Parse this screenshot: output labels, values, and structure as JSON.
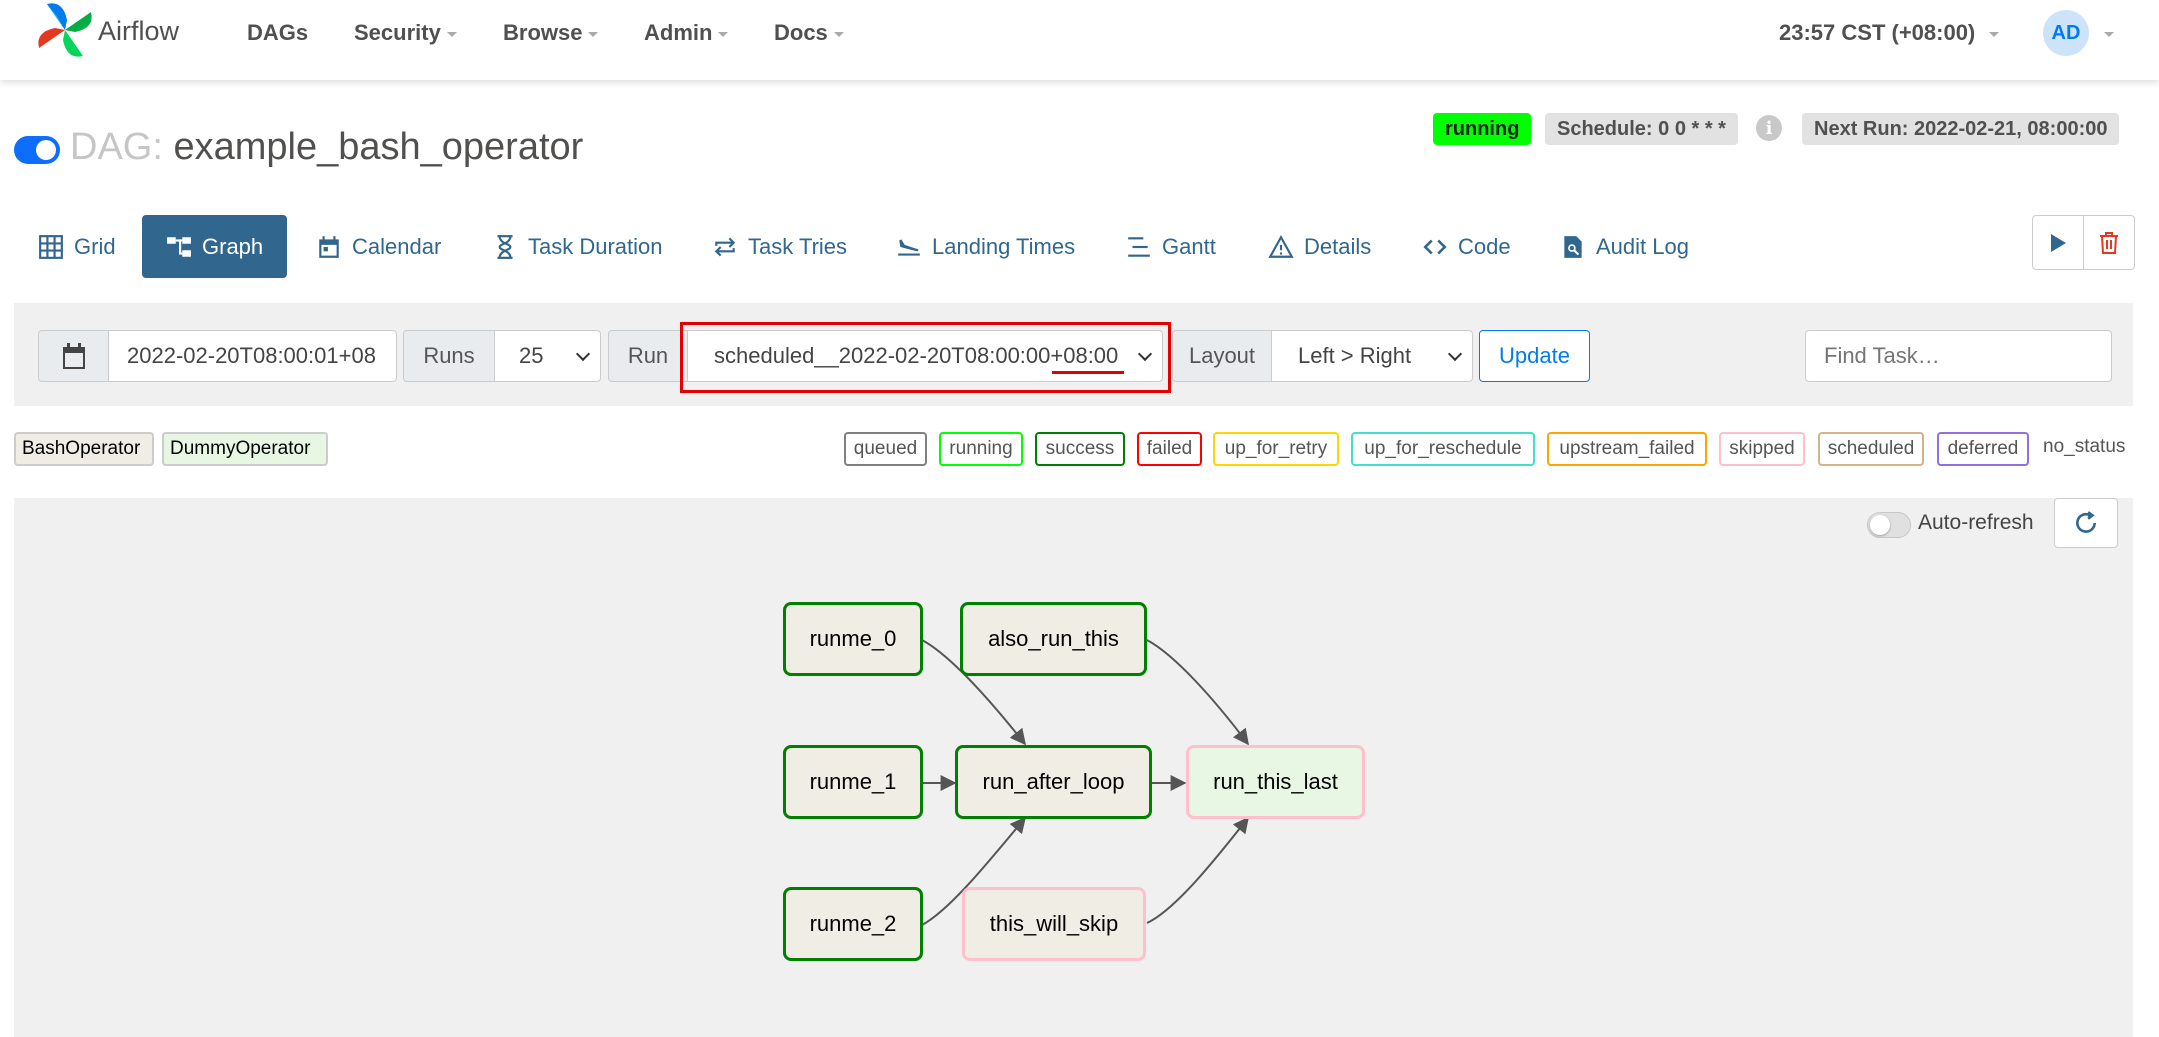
{
  "brand": {
    "name": "Airflow"
  },
  "nav": {
    "items": [
      {
        "label": "DAGs",
        "dropdown": false
      },
      {
        "label": "Security",
        "dropdown": true
      },
      {
        "label": "Browse",
        "dropdown": true
      },
      {
        "label": "Admin",
        "dropdown": true
      },
      {
        "label": "Docs",
        "dropdown": true
      }
    ],
    "clock": "23:57 CST (+08:00)",
    "user_initials": "AD"
  },
  "dag": {
    "prefix": "DAG:",
    "name": "example_bash_operator",
    "enabled": true,
    "state": "running",
    "schedule": "Schedule: 0 0 * * *",
    "next_run": "Next Run: 2022-02-21, 08:00:00"
  },
  "tabs": [
    {
      "label": "Grid",
      "icon": "grid-icon",
      "active": false
    },
    {
      "label": "Graph",
      "icon": "graph-icon",
      "active": true
    },
    {
      "label": "Calendar",
      "icon": "calendar-icon",
      "active": false
    },
    {
      "label": "Task Duration",
      "icon": "hourglass-icon",
      "active": false
    },
    {
      "label": "Task Tries",
      "icon": "repeat-icon",
      "active": false
    },
    {
      "label": "Landing Times",
      "icon": "plane-landing-icon",
      "active": false
    },
    {
      "label": "Gantt",
      "icon": "gantt-icon",
      "active": false
    },
    {
      "label": "Details",
      "icon": "warning-triangle-icon",
      "active": false
    },
    {
      "label": "Code",
      "icon": "code-icon",
      "active": false
    },
    {
      "label": "Audit Log",
      "icon": "file-search-icon",
      "active": false
    }
  ],
  "controls": {
    "base_date": "2022-02-20T08:00:01+08",
    "runs_label": "Runs",
    "runs_value": "25",
    "run_label": "Run",
    "run_value": "scheduled__2022-02-20T08:00:00+08:00",
    "layout_label": "Layout",
    "layout_value": "Left > Right",
    "update_label": "Update",
    "find_placeholder": "Find Task…"
  },
  "operators": [
    {
      "label": "BashOperator",
      "color": "#f0ede4"
    },
    {
      "label": "DummyOperator",
      "color": "#e8f7e4"
    }
  ],
  "states": [
    {
      "label": "queued",
      "color": "#808080"
    },
    {
      "label": "running",
      "color": "#00ff00"
    },
    {
      "label": "success",
      "color": "#008000"
    },
    {
      "label": "failed",
      "color": "#ff0000"
    },
    {
      "label": "up_for_retry",
      "color": "#ffd700"
    },
    {
      "label": "up_for_reschedule",
      "color": "#40e0d0"
    },
    {
      "label": "upstream_failed",
      "color": "#ffa500"
    },
    {
      "label": "skipped",
      "color": "#ffc0cb"
    },
    {
      "label": "scheduled",
      "color": "#d2b48c"
    },
    {
      "label": "deferred",
      "color": "#9370db"
    },
    {
      "label": "no_status",
      "color": ""
    }
  ],
  "graph": {
    "auto_refresh_label": "Auto-refresh",
    "auto_refresh": false,
    "nodes": [
      {
        "id": "runme_0",
        "label": "runme_0",
        "operator": "BashOperator",
        "state": "success"
      },
      {
        "id": "also_run_this",
        "label": "also_run_this",
        "operator": "BashOperator",
        "state": "success"
      },
      {
        "id": "runme_1",
        "label": "runme_1",
        "operator": "BashOperator",
        "state": "success"
      },
      {
        "id": "run_after_loop",
        "label": "run_after_loop",
        "operator": "BashOperator",
        "state": "success"
      },
      {
        "id": "run_this_last",
        "label": "run_this_last",
        "operator": "DummyOperator",
        "state": "skipped"
      },
      {
        "id": "runme_2",
        "label": "runme_2",
        "operator": "BashOperator",
        "state": "success"
      },
      {
        "id": "this_will_skip",
        "label": "this_will_skip",
        "operator": "BashOperator",
        "state": "skipped"
      }
    ],
    "edges": [
      [
        "runme_0",
        "run_after_loop"
      ],
      [
        "runme_1",
        "run_after_loop"
      ],
      [
        "runme_2",
        "run_after_loop"
      ],
      [
        "run_after_loop",
        "run_this_last"
      ],
      [
        "also_run_this",
        "run_this_last"
      ],
      [
        "this_will_skip",
        "run_this_last"
      ]
    ]
  }
}
